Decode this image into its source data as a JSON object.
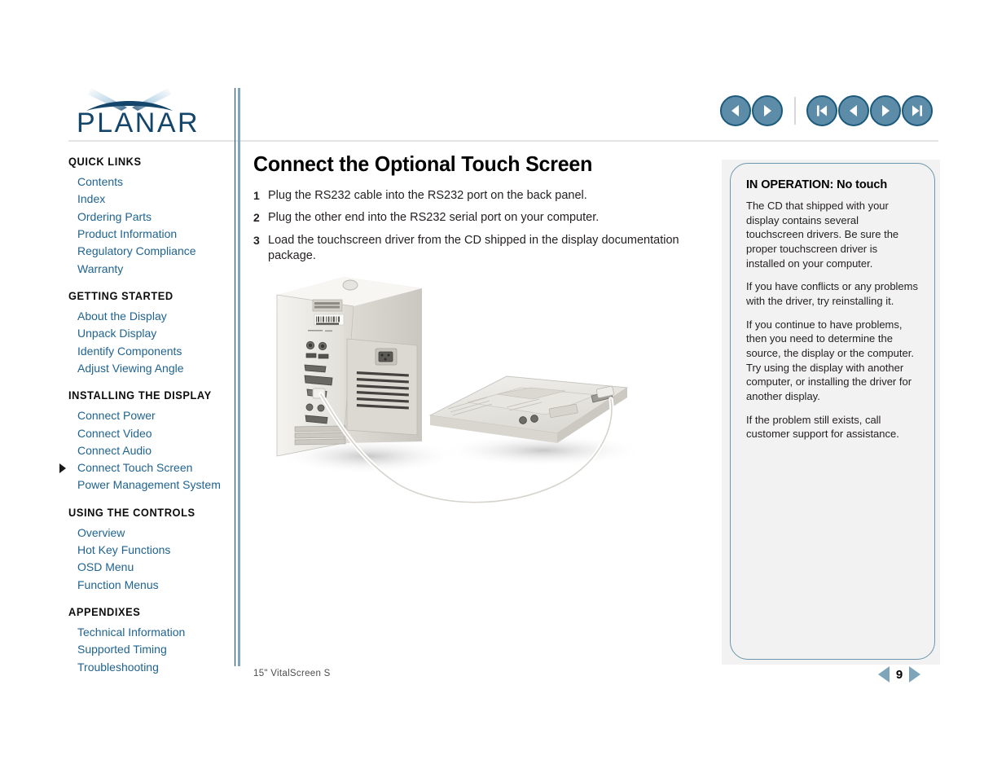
{
  "brand": {
    "logo_text": "PLANAR",
    "logo_color": "#14466b"
  },
  "topnav": {
    "buttons": [
      {
        "name": "back-button",
        "icon": "triangle-left-icon",
        "label": "Back"
      },
      {
        "name": "forward-button",
        "icon": "triangle-right-icon",
        "label": "Forward"
      },
      {
        "name": "first-page-button",
        "icon": "skip-to-start-icon",
        "label": "First page"
      },
      {
        "name": "previous-page-button",
        "icon": "triangle-left-icon",
        "label": "Previous page"
      },
      {
        "name": "next-page-button",
        "icon": "triangle-right-icon",
        "label": "Next page"
      },
      {
        "name": "last-page-button",
        "icon": "skip-to-end-icon",
        "label": "Last page"
      }
    ]
  },
  "sidebar": {
    "sections": [
      {
        "title": "QUICK LINKS",
        "items": [
          {
            "label": "Contents",
            "active": false
          },
          {
            "label": "Index",
            "active": false
          },
          {
            "label": "Ordering Parts",
            "active": false
          },
          {
            "label": "Product Information",
            "active": false
          },
          {
            "label": "Regulatory Compliance",
            "active": false
          },
          {
            "label": "Warranty",
            "active": false
          }
        ]
      },
      {
        "title": "GETTING STARTED",
        "items": [
          {
            "label": "About the Display",
            "active": false
          },
          {
            "label": "Unpack Display",
            "active": false
          },
          {
            "label": "Identify Components",
            "active": false
          },
          {
            "label": "Adjust Viewing Angle",
            "active": false
          }
        ]
      },
      {
        "title": "INSTALLING THE DISPLAY",
        "items": [
          {
            "label": "Connect Power",
            "active": false
          },
          {
            "label": "Connect Video",
            "active": false
          },
          {
            "label": "Connect Audio",
            "active": false
          },
          {
            "label": "Connect Touch Screen",
            "active": true
          },
          {
            "label": "Power Management System",
            "active": false
          }
        ]
      },
      {
        "title": "USING THE CONTROLS",
        "items": [
          {
            "label": "Overview",
            "active": false
          },
          {
            "label": "Hot Key Functions",
            "active": false
          },
          {
            "label": "OSD Menu",
            "active": false
          },
          {
            "label": "Function Menus",
            "active": false
          }
        ]
      },
      {
        "title": "APPENDIXES",
        "items": [
          {
            "label": "Technical Information",
            "active": false
          },
          {
            "label": "Supported Timing",
            "active": false
          },
          {
            "label": "Troubleshooting",
            "active": false
          }
        ]
      }
    ]
  },
  "main": {
    "title": "Connect the Optional Touch Screen",
    "steps": [
      {
        "num": "1",
        "text": "Plug the RS232 cable into the RS232 port on the back panel."
      },
      {
        "num": "2",
        "text": "Plug the other end into the RS232 serial port on your computer."
      },
      {
        "num": "3",
        "text": "Load the touchscreen driver from the CD shipped in the display documentation package."
      }
    ],
    "figure": {
      "name": "computer-tower-and-display-photo",
      "description": "Photograph of a beige computer tower rear panel connected by a serial cable to a flat panel display lying face down"
    }
  },
  "note": {
    "title_bold": "IN OPERATION:",
    "title_rest": " No touch",
    "paragraphs": [
      "The CD that shipped with your display contains several touchscreen drivers. Be sure the proper touchscreen driver is installed on your computer.",
      "If you have conflicts or any problems with the driver, try reinstalling it.",
      "If you continue to have problems, then you need to determine the source, the display or the computer. Try using the display with another computer, or installing the driver for another display.",
      "If the problem still exists, call customer support for assistance."
    ]
  },
  "footer": {
    "product_label": "15\" VitalScreen S",
    "page_number": "9"
  },
  "colors": {
    "link": "#1f6391",
    "brand_navy": "#14466b",
    "button_fill": "#5d8ca8",
    "button_rim": "#1b5a7d",
    "panel_border": "#6d97ae",
    "panel_bg": "#f2f2f2"
  }
}
